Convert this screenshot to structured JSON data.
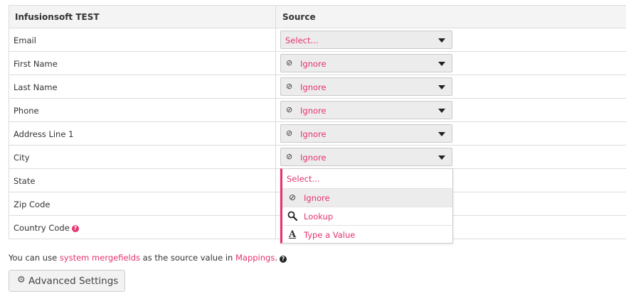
{
  "table": {
    "col_destination": "Infusionsoft TEST",
    "col_source": "Source",
    "rows": [
      {
        "field": "Email",
        "value": "Select...",
        "icon": ""
      },
      {
        "field": "First Name",
        "value": "Ignore",
        "icon": "⊘"
      },
      {
        "field": "Last Name",
        "value": "Ignore",
        "icon": "⊘"
      },
      {
        "field": "Phone",
        "value": "Ignore",
        "icon": "⊘"
      },
      {
        "field": "Address Line 1",
        "value": "Ignore",
        "icon": "⊘"
      },
      {
        "field": "City",
        "value": "Ignore",
        "icon": "⊘"
      },
      {
        "field": "State"
      },
      {
        "field": "Zip Code"
      },
      {
        "field": "Country Code",
        "help": "?"
      }
    ]
  },
  "dropdown": {
    "options": [
      {
        "label": "Select...",
        "icon": ""
      },
      {
        "label": "Ignore",
        "icon": "⊘"
      },
      {
        "label": "Lookup",
        "icon": "🔍"
      },
      {
        "label": "Type a Value",
        "icon": "A"
      }
    ]
  },
  "note": {
    "prefix": "You can use ",
    "link1": "system mergefields",
    "middle": " as the source value in ",
    "link2": "Mappings",
    "suffix": ".",
    "help": "?"
  },
  "advanced_button": {
    "label": "Advanced Settings",
    "icon": "⚙"
  },
  "colors": {
    "accent": "#e5336f"
  }
}
